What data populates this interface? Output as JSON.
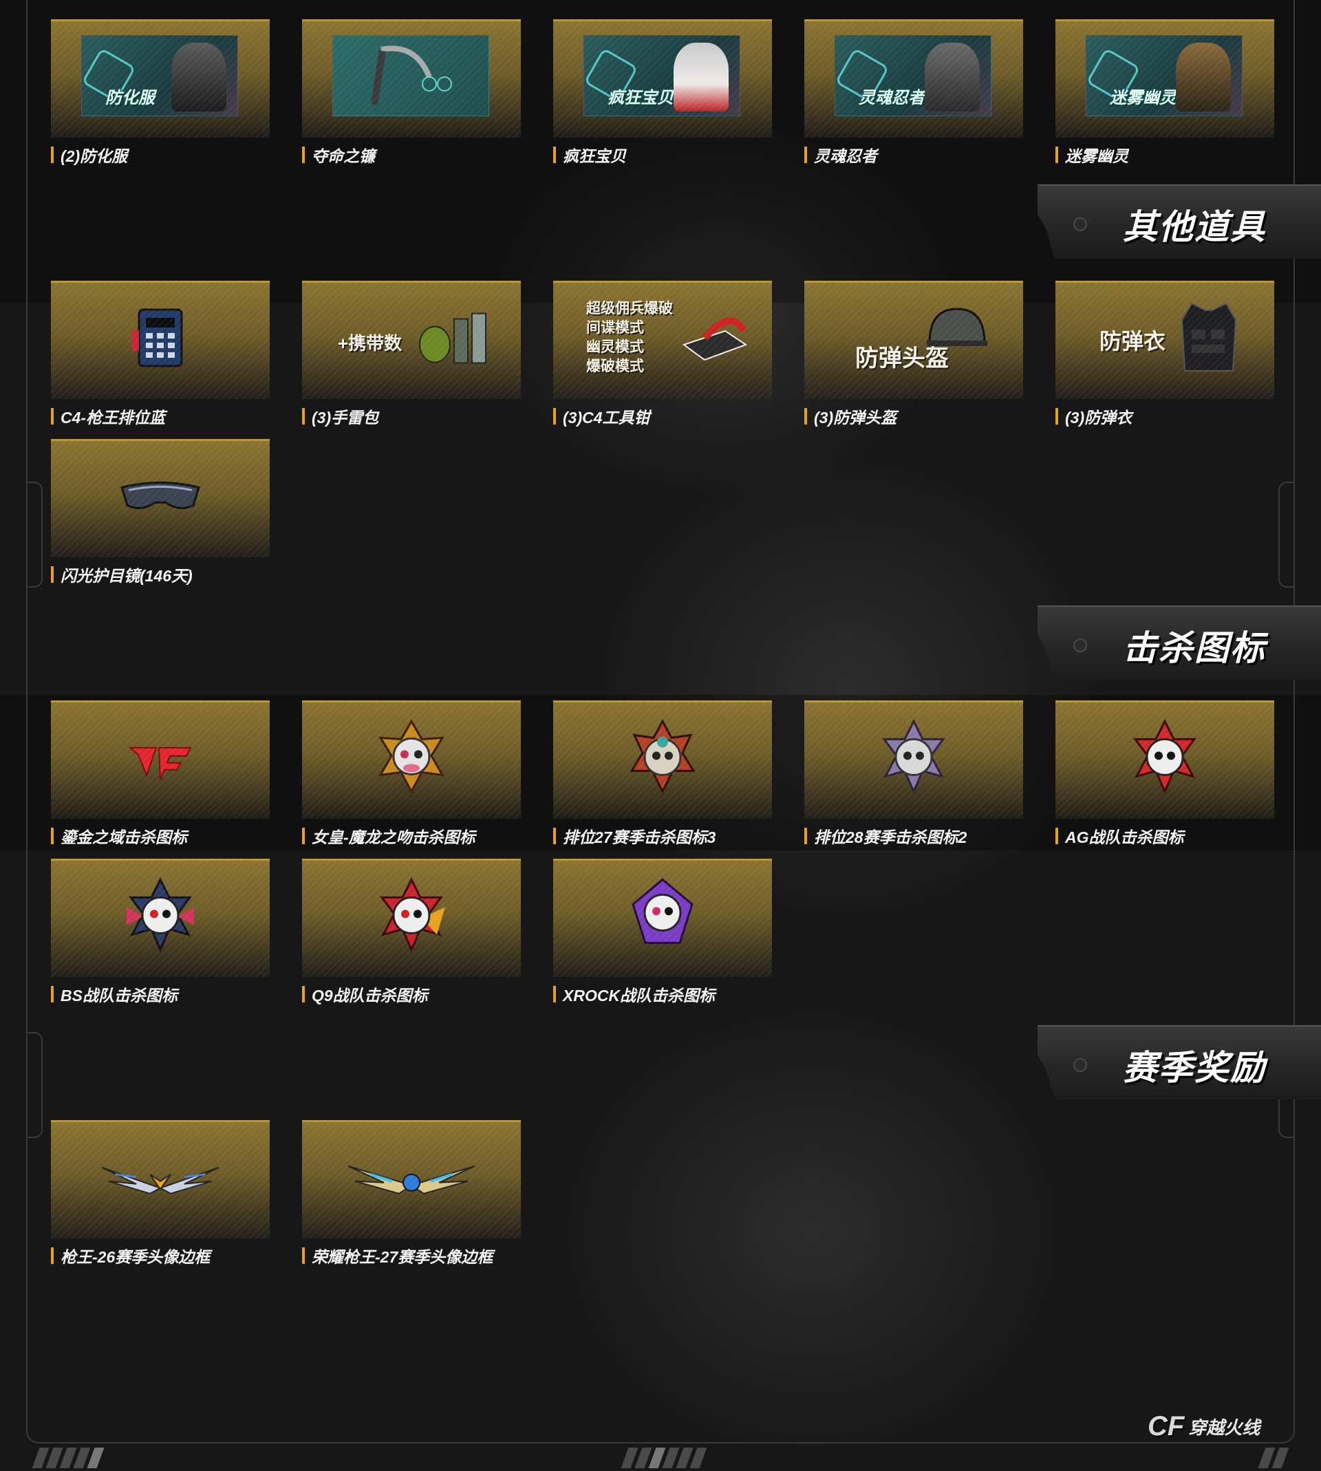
{
  "sections": {
    "other_items": "其他道具",
    "kill_icons": "击杀图标",
    "season_rewards": "赛季奖励"
  },
  "row1": [
    {
      "label": "(2)防化服",
      "thumb_text": "防化服",
      "icon": "hazmat-suit-icon"
    },
    {
      "label": "夺命之镰",
      "thumb_text": "",
      "icon": "scythe-icon"
    },
    {
      "label": "疯狂宝贝",
      "thumb_text": "疯狂宝贝",
      "icon": "zombie-character-icon"
    },
    {
      "label": "灵魂忍者",
      "thumb_text": "灵魂忍者",
      "icon": "zombie-character-icon"
    },
    {
      "label": "迷雾幽灵",
      "thumb_text": "迷雾幽灵",
      "icon": "zombie-character-icon"
    }
  ],
  "other": [
    {
      "label": "C4-枪王排位蓝",
      "icon": "c4-bomb-icon"
    },
    {
      "label": "(3)手雷包",
      "thumb_text": "+携带数",
      "icon": "grenade-pack-icon"
    },
    {
      "label": "(3)C4工具钳",
      "thumb_lines": [
        "超级佣兵爆破",
        "间谍模式",
        "幽灵模式",
        "爆破模式"
      ],
      "icon": "c4-pliers-icon"
    },
    {
      "label": "(3)防弹头盔",
      "thumb_text": "防弹头盔",
      "icon": "helmet-icon"
    },
    {
      "label": "(3)防弹衣",
      "thumb_text": "防弹衣",
      "icon": "body-armor-icon"
    },
    {
      "label": "闪光护目镜(146天)",
      "icon": "goggles-icon"
    }
  ],
  "kill": [
    {
      "label": "鎏金之域击杀图标",
      "icon": "cf-logo-icon"
    },
    {
      "label": "女皇-魔龙之吻击杀图标",
      "icon": "skull-badge-icon"
    },
    {
      "label": "排位27赛季击杀图标3",
      "icon": "skull-badge-icon"
    },
    {
      "label": "排位28赛季击杀图标2",
      "icon": "skull-badge-icon"
    },
    {
      "label": "AG战队击杀图标",
      "icon": "skull-badge-icon"
    },
    {
      "label": "BS战队击杀图标",
      "icon": "skull-badge-icon"
    },
    {
      "label": "Q9战队击杀图标",
      "icon": "skull-badge-icon"
    },
    {
      "label": "XROCK战队击杀图标",
      "icon": "skull-badge-icon"
    }
  ],
  "season": [
    {
      "label": "枪王-26赛季头像边框",
      "icon": "winged-frame-icon"
    },
    {
      "label": "荣耀枪王-27赛季头像边框",
      "icon": "winged-frame-icon"
    }
  ],
  "logo": {
    "text": "穿越火线",
    "mark": "CF"
  },
  "colors": {
    "gold": "#8a7332",
    "accent": "#e7a21f",
    "teal": "#2a5c5c"
  }
}
